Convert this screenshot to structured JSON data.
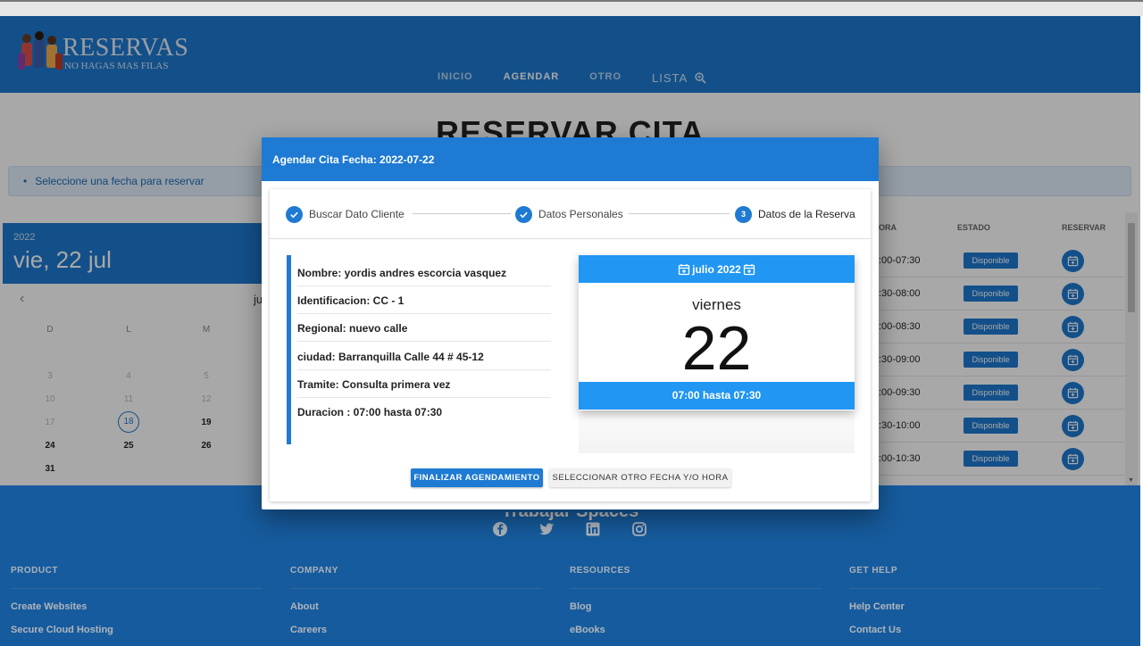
{
  "header": {
    "logo_title": "RESERVAS",
    "logo_subtitle": "NO HAGAS MAS FILAS",
    "nav": [
      "INICIO",
      "AGENDAR",
      "OTRO",
      "LISTA"
    ],
    "active_tab": "AGENDAR"
  },
  "page": {
    "title": "RESERVAR CITA",
    "alert": "Seleccione una fecha para reservar"
  },
  "date_picker": {
    "year": "2022",
    "date": "vie, 22 jul",
    "month_label": "ju",
    "weekdays": [
      "D",
      "L",
      "M"
    ],
    "days": [
      [
        "3",
        "4",
        "5"
      ],
      [
        "10",
        "11",
        "12"
      ],
      [
        "17",
        "18",
        "19"
      ],
      [
        "24",
        "25",
        "26"
      ],
      [
        "31"
      ]
    ],
    "selected_day": "18"
  },
  "slots_table": {
    "headers": [
      "ORA",
      "ESTADO",
      "RESERVAR"
    ],
    "rows": [
      {
        "hora": ":00-07:30",
        "estado": "Disponible"
      },
      {
        "hora": ":30-08:00",
        "estado": "Disponible"
      },
      {
        "hora": ":00-08:30",
        "estado": "Disponible"
      },
      {
        "hora": ":30-09:00",
        "estado": "Disponible"
      },
      {
        "hora": ":00-09:30",
        "estado": "Disponible"
      },
      {
        "hora": ":30-10:00",
        "estado": "Disponible"
      },
      {
        "hora": ":00-10:30",
        "estado": "Disponible"
      }
    ]
  },
  "modal": {
    "title": "Agendar Cita Fecha: 2022-07-22",
    "steps": [
      {
        "label": "Buscar Dato Cliente",
        "status": "done"
      },
      {
        "label": "Datos Personales",
        "status": "done"
      },
      {
        "label": "Datos de la Reserva",
        "status": "current",
        "number": "3"
      }
    ],
    "details": [
      "Nombre: yordis andres escorcia vasquez",
      "Identificacion: CC - 1",
      "Regional: nuevo calle",
      "ciudad: Barranquilla Calle 44 # 45-12",
      "Tramite: Consulta primera vez",
      "Duracion : 07:00 hasta 07:30"
    ],
    "date_card": {
      "month": "julio 2022",
      "weekday": "viernes",
      "day": "22",
      "time": "07:00 hasta 07:30"
    },
    "buttons": {
      "primary": "FINALIZAR AGENDAMIENTO",
      "secondary": "SELECCIONAR OTRO FECHA Y/O HORA"
    }
  },
  "footer": {
    "title": "Trabajar Spaces",
    "columns": [
      {
        "heading": "PRODUCT",
        "links": [
          "Create Websites",
          "Secure Cloud Hosting"
        ]
      },
      {
        "heading": "COMPANY",
        "links": [
          "About",
          "Careers"
        ]
      },
      {
        "heading": "RESOURCES",
        "links": [
          "Blog",
          "eBooks"
        ]
      },
      {
        "heading": "GET HELP",
        "links": [
          "Help Center",
          "Contact Us"
        ]
      }
    ],
    "social": [
      "facebook-icon",
      "twitter-icon",
      "linkedin-icon",
      "instagram-icon"
    ]
  },
  "colors": {
    "primary": "#1e7ad2",
    "accent": "#2196f3",
    "footer": "#1e7ad2"
  }
}
